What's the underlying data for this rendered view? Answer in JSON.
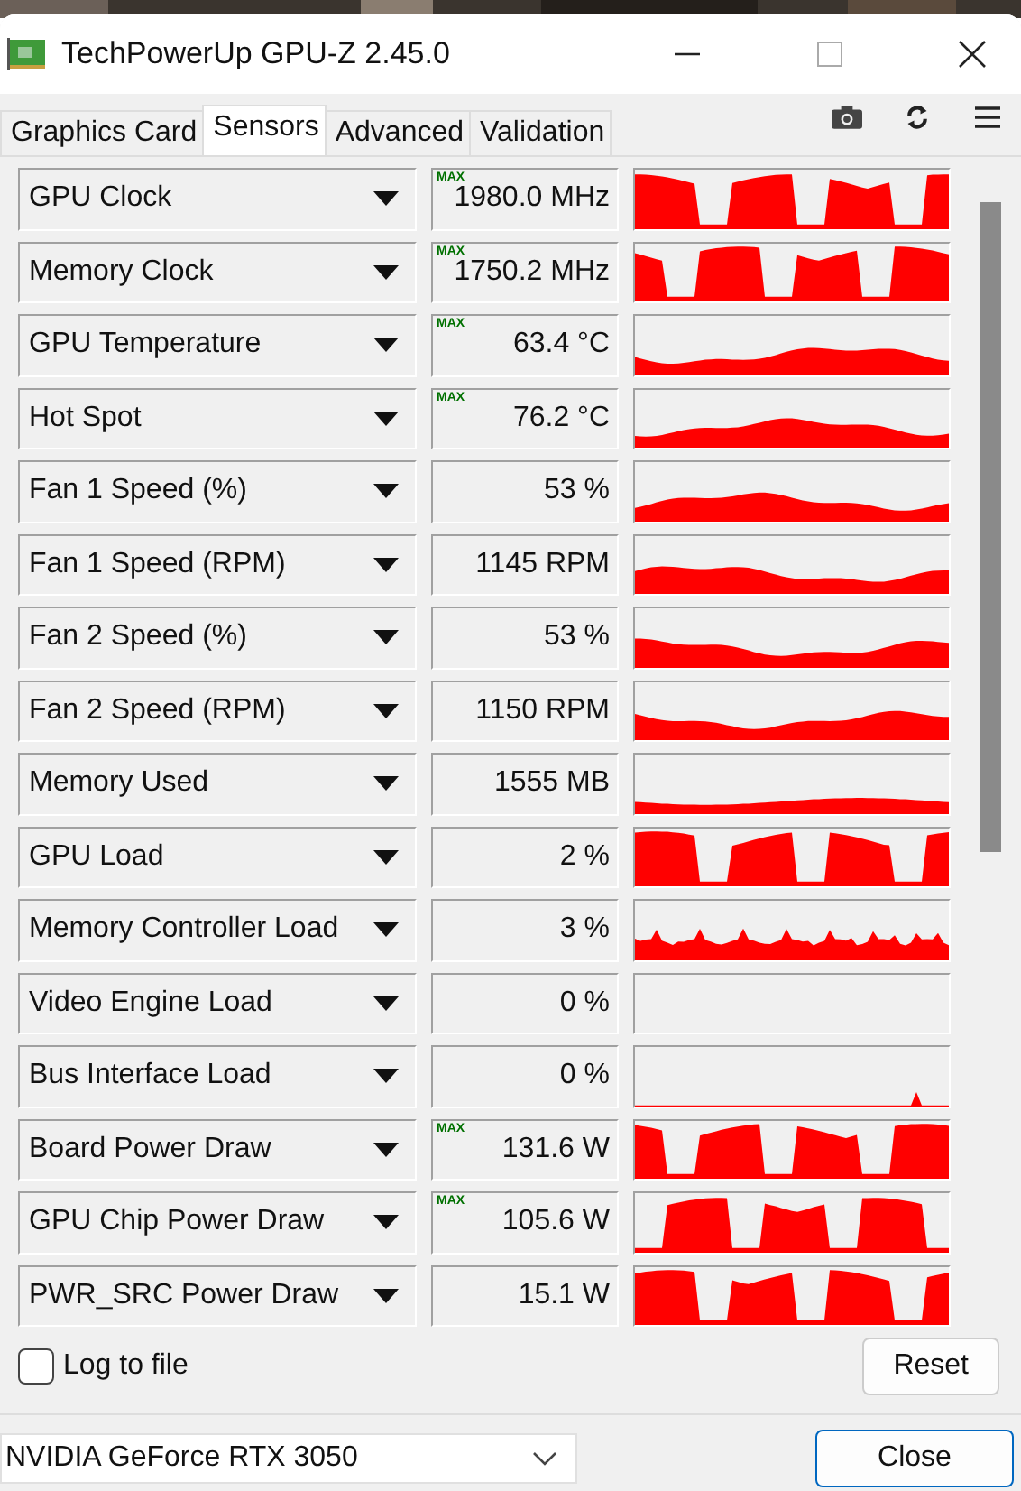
{
  "window": {
    "title": "TechPowerUp GPU-Z 2.45.0"
  },
  "tabs": [
    {
      "label": "Graphics Card",
      "selected": false
    },
    {
      "label": "Sensors",
      "selected": true
    },
    {
      "label": "Advanced",
      "selected": false
    },
    {
      "label": "Validation",
      "selected": false
    }
  ],
  "sensors": [
    {
      "name": "GPU Clock",
      "badge": "MAX",
      "value": "1980.0 MHz"
    },
    {
      "name": "Memory Clock",
      "badge": "MAX",
      "value": "1750.2 MHz"
    },
    {
      "name": "GPU Temperature",
      "badge": "MAX",
      "value": "63.4 °C"
    },
    {
      "name": "Hot Spot",
      "badge": "MAX",
      "value": "76.2 °C"
    },
    {
      "name": "Fan 1 Speed (%)",
      "value": "53 %"
    },
    {
      "name": "Fan 1 Speed (RPM)",
      "value": "1145 RPM"
    },
    {
      "name": "Fan 2 Speed (%)",
      "value": "53 %"
    },
    {
      "name": "Fan 2 Speed (RPM)",
      "value": "1150 RPM"
    },
    {
      "name": "Memory Used",
      "value": "1555 MB"
    },
    {
      "name": "GPU Load",
      "value": "2 %"
    },
    {
      "name": "Memory Controller Load",
      "value": "3 %"
    },
    {
      "name": "Video Engine Load",
      "value": "0 %"
    },
    {
      "name": "Bus Interface Load",
      "value": "0 %"
    },
    {
      "name": "Board Power Draw",
      "badge": "MAX",
      "value": "131.6 W"
    },
    {
      "name": "GPU Chip Power Draw",
      "badge": "MAX",
      "value": "105.6 W"
    },
    {
      "name": "PWR_SRC Power Draw",
      "value": "15.1 W"
    }
  ],
  "log_to_file": {
    "label": "Log to file",
    "checked": false
  },
  "reset_button": "Reset",
  "device": {
    "value": "NVIDIA GeForce RTX 3050"
  },
  "close_button": "Close"
}
